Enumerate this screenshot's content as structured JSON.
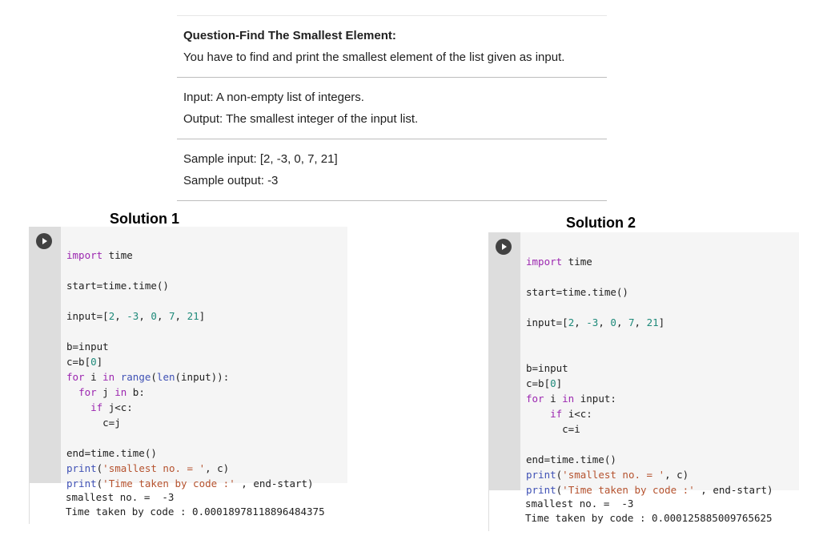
{
  "question": {
    "title": "Question-Find The Smallest Element:",
    "description": "You have to find and print the smallest element of the list given as input.",
    "input": "Input: A non-empty list of integers.",
    "output": "Output: The smallest integer of the input list.",
    "sample_input": "Sample input: [2, -3, 0, 7, 21]",
    "sample_output": "Sample output: -3"
  },
  "solution1": {
    "heading": "Solution 1",
    "code": {
      "l1_kw": "import",
      "l1_rest": " time",
      "l2": "start=time.time()",
      "l3_a": "input=[2, ",
      "l3_n1": "-3",
      "l3_b": ", ",
      "l3_n2": "0",
      "l3_c": ", ",
      "l3_n3": "7",
      "l3_d": ", ",
      "l3_n4": "21",
      "l3_e": "]",
      "l3_n0": "2",
      "l4": "b=input",
      "l5_a": "c=b[",
      "l5_n": "0",
      "l5_b": "]",
      "l6_kw": "for",
      "l6_a": " i ",
      "l6_kw2": "in",
      "l6_b": " ",
      "l6_fn": "range",
      "l6_c": "(",
      "l6_fn2": "len",
      "l6_d": "(input)):",
      "l7_ind": "  ",
      "l7_kw": "for",
      "l7_a": " j ",
      "l7_kw2": "in",
      "l7_b": " b:",
      "l8_ind": "    ",
      "l8_kw": "if",
      "l8_a": " j<c:",
      "l9": "      c=j",
      "l10": "end=time.time()",
      "l11_fn": "print",
      "l11_a": "(",
      "l11_s": "'smallest no. = '",
      "l11_b": ", c)",
      "l12_fn": "print",
      "l12_a": "(",
      "l12_s": "'Time taken by code :'",
      "l12_b": " , end-start)"
    },
    "output": {
      "line1": "smallest no. =  -3",
      "line2": "Time taken by code : 0.00018978118896484375"
    }
  },
  "solution2": {
    "heading": "Solution 2",
    "code": {
      "l1_kw": "import",
      "l1_rest": " time",
      "l2": "start=time.time()",
      "l3_a": "input=[",
      "l3_n0": "2",
      "l3_b0": ", ",
      "l3_n1": "-3",
      "l3_b": ", ",
      "l3_n2": "0",
      "l3_c": ", ",
      "l3_n3": "7",
      "l3_d": ", ",
      "l3_n4": "21",
      "l3_e": "]",
      "l4": "b=input",
      "l5_a": "c=b[",
      "l5_n": "0",
      "l5_b": "]",
      "l6_kw": "for",
      "l6_a": " i ",
      "l6_kw2": "in",
      "l6_b": " input:",
      "l7_ind": "    ",
      "l7_kw": "if",
      "l7_a": " i<c:",
      "l8": "      c=i",
      "l9": "end=time.time()",
      "l10_fn": "print",
      "l10_a": "(",
      "l10_s": "'smallest no. = '",
      "l10_b": ", c)",
      "l11_fn": "print",
      "l11_a": "(",
      "l11_s": "'Time taken by code :'",
      "l11_b": " , end-start)"
    },
    "output": {
      "line1": "smallest no. =  -3",
      "line2": "Time taken by code : 0.000125885009765625"
    }
  },
  "colors": {
    "keyword": "#9c27b0",
    "keyword_in": "#3f51b5",
    "number": "#1e8a7a",
    "string": "#b5522e",
    "cell_background": "#f5f5f5",
    "gutter": "#dddddd",
    "run_button": "#424242"
  },
  "icons": {
    "run": "play-circle-icon"
  }
}
